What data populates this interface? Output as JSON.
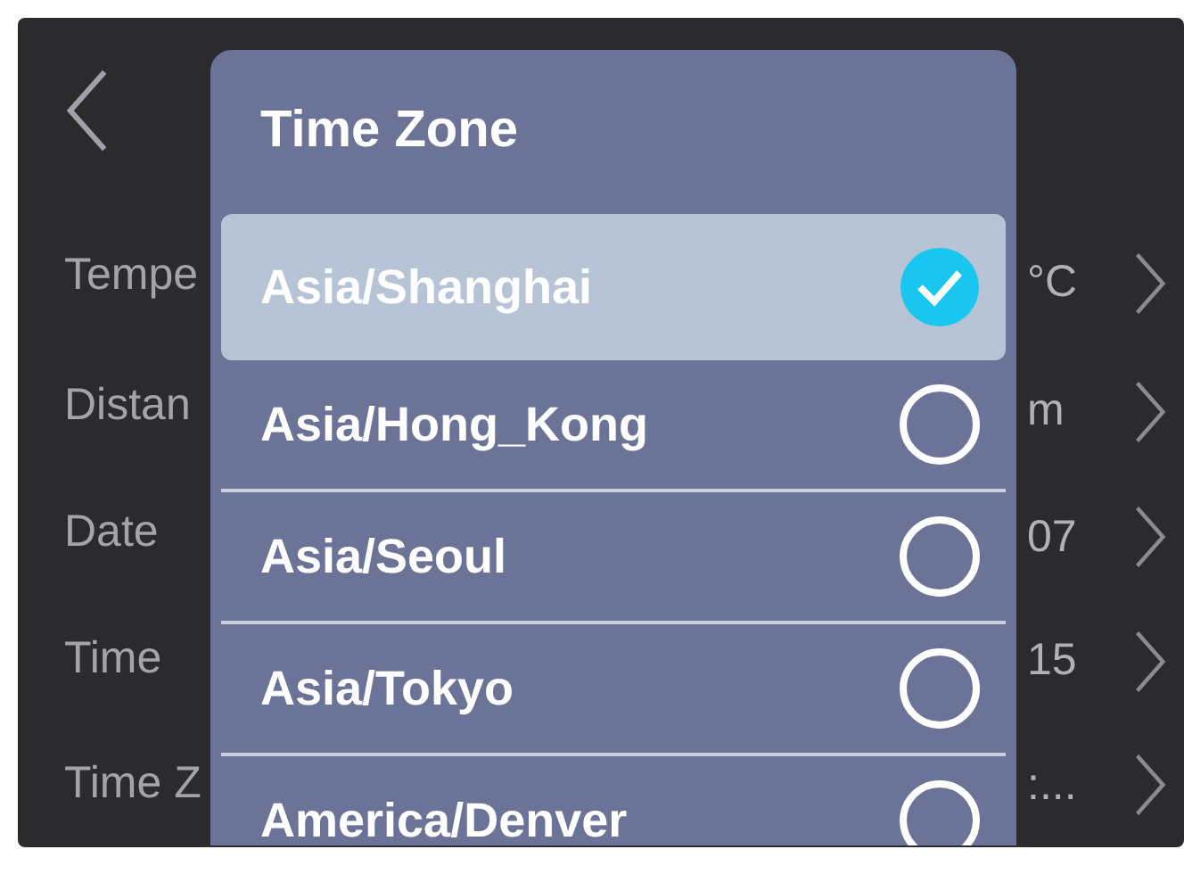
{
  "settings": [
    {
      "label": "Tempe",
      "value": "°C"
    },
    {
      "label": "Distan",
      "value": "m"
    },
    {
      "label": "Date",
      "value": "07"
    },
    {
      "label": "Time",
      "value": "15"
    },
    {
      "label": "Time Z",
      "value": ":..."
    }
  ],
  "dialog": {
    "title": "Time Zone",
    "options": [
      {
        "label": "Asia/Shanghai",
        "selected": true
      },
      {
        "label": "Asia/Hong_Kong",
        "selected": false
      },
      {
        "label": "Asia/Seoul",
        "selected": false
      },
      {
        "label": "Asia/Tokyo",
        "selected": false
      },
      {
        "label": "America/Denver",
        "selected": false
      }
    ]
  }
}
